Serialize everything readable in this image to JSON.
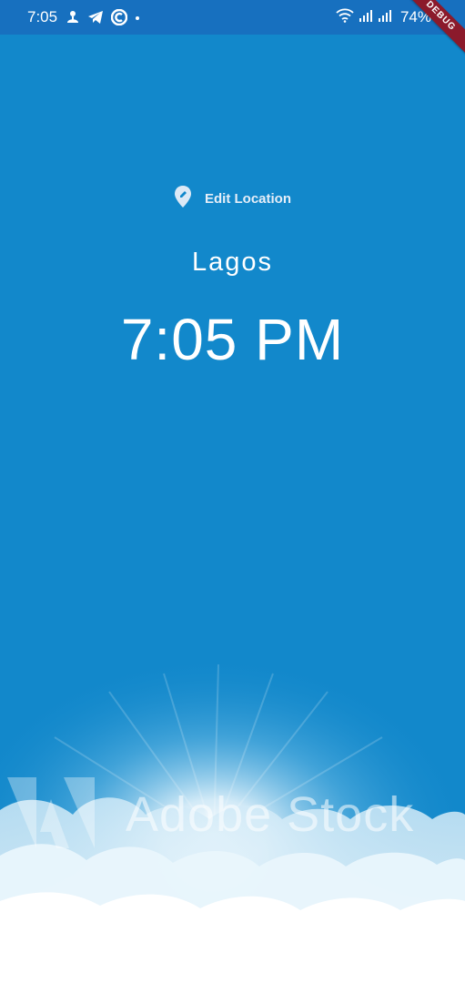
{
  "status_bar": {
    "time": "7:05",
    "battery_percent": "74%",
    "left_icons": [
      "weather-icon",
      "telegram-icon",
      "c-app-icon",
      "dot-icon"
    ],
    "right_icons": [
      "wifi-icon",
      "signal-icon",
      "signal-icon",
      "battery-icon"
    ]
  },
  "debug_banner": {
    "label": "DEBUG"
  },
  "location": {
    "edit_label": "Edit Location",
    "icon": "edit-location-icon",
    "city": "Lagos",
    "time": "7:05 PM"
  },
  "background": {
    "watermark_text": "Adobe Stock"
  },
  "colors": {
    "sky": "#1288cb",
    "status_bar": "#1770bf",
    "debug_banner": "#8b1a2b"
  }
}
